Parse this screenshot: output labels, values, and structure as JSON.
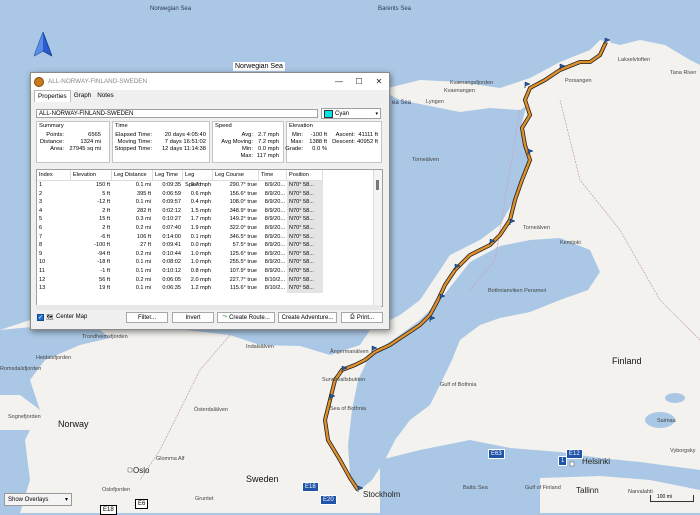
{
  "dialog": {
    "title": "ALL-NORWAY-FINLAND-SWEDEN",
    "tabs": [
      "Properties",
      "Graph",
      "Notes"
    ],
    "track_name": "ALL-NORWAY-FINLAND-SWEDEN",
    "color_label": "Cyan",
    "color_hex": "#00e6e6",
    "summary": {
      "header": "Summary",
      "points_label": "Points:",
      "points": "6565",
      "distance_label": "Distance:",
      "distance": "1324 mi",
      "area_label": "Area:",
      "area": "27945 sq mi"
    },
    "time": {
      "header": "Time",
      "elapsed_label": "Elapsed Time:",
      "elapsed": "20 days 4:05:40",
      "moving_label": "Moving Time:",
      "moving": "7 days 16:51:02",
      "stopped_label": "Stopped Time:",
      "stopped": "12 days 11:14:38"
    },
    "speed": {
      "header": "Speed",
      "avg_label": "Avg:",
      "avg": "2.7 mph",
      "avg_moving_label": "Avg Moving:",
      "avg_moving": "7.2 mph",
      "min_label": "Min:",
      "min": "0.0 mph",
      "max_label": "Max:",
      "max": "117 mph"
    },
    "elevation": {
      "header": "Elevation",
      "min_label": "Min:",
      "min": "-100 ft",
      "max_label": "Max:",
      "max": "1388 ft",
      "grade_label": "Grade:",
      "grade": "0.0 %",
      "ascent_label": "Ascent:",
      "ascent": "41111 ft",
      "descent_label": "Descent:",
      "descent": "40952 ft"
    },
    "table": {
      "columns": [
        "Index",
        "Elevation",
        "Leg Distance",
        "Leg Time",
        "Leg Speed",
        "Leg Course",
        "Time",
        "Position"
      ],
      "rows": [
        [
          "1",
          "150 ft",
          "0.1 mi",
          "0:09:35",
          "0.7 mph",
          "290.7° true",
          "8/9/20...",
          "N70° 58..."
        ],
        [
          "2",
          "5 ft",
          "395 ft",
          "0:06:59",
          "0.6 mph",
          "156.6° true",
          "8/9/20...",
          "N70° 58..."
        ],
        [
          "3",
          "-12 ft",
          "0.1 mi",
          "0:09:57",
          "0.4 mph",
          "108.0° true",
          "8/9/20...",
          "N70° 58..."
        ],
        [
          "4",
          "2 ft",
          "282 ft",
          "0:02:12",
          "1.5 mph",
          "348.9° true",
          "8/9/20...",
          "N70° 58..."
        ],
        [
          "5",
          "15 ft",
          "0.3 mi",
          "0:10:27",
          "1.7 mph",
          "149.2° true",
          "8/9/20...",
          "N70° 58..."
        ],
        [
          "6",
          "2 ft",
          "0.2 mi",
          "0:07:40",
          "1.9 mph",
          "322.0° true",
          "8/9/20...",
          "N70° 58..."
        ],
        [
          "7",
          "-6 ft",
          "106 ft",
          "0:14:00",
          "0.1 mph",
          "346.5° true",
          "8/9/20...",
          "N70° 58..."
        ],
        [
          "8",
          "-100 ft",
          "27 ft",
          "0:09:41",
          "0.0 mph",
          "57.5° true",
          "8/9/20...",
          "N70° 58..."
        ],
        [
          "9",
          "-94 ft",
          "0.2 mi",
          "0:10:44",
          "1.0 mph",
          "125.6° true",
          "8/9/20...",
          "N70° 58..."
        ],
        [
          "10",
          "-18 ft",
          "0.1 mi",
          "0:08:02",
          "1.0 mph",
          "255.5° true",
          "8/9/20...",
          "N70° 58..."
        ],
        [
          "11",
          "-1 ft",
          "0.1 mi",
          "0:10:12",
          "0.8 mph",
          "107.9° true",
          "8/9/20...",
          "N70° 58..."
        ],
        [
          "12",
          "56 ft",
          "0.2 mi",
          "0:06:05",
          "2.0 mph",
          "227.7° true",
          "8/10/2...",
          "N70° 58..."
        ],
        [
          "13",
          "19 ft",
          "0.1 mi",
          "0:06:35",
          "1.2 mph",
          "115.6° true",
          "8/10/2...",
          "N70° 58..."
        ]
      ]
    },
    "buttons": {
      "center_map": "Center Map",
      "filter": "Filter...",
      "invert": "Invert",
      "create_route": "Create Route...",
      "create_adventure": "Create Adventure...",
      "print": "Print..."
    },
    "window_buttons": {
      "minimize": "—",
      "maximize": "☐",
      "close": "✕"
    }
  },
  "map": {
    "labels": {
      "norwegian_sea_top": "Norwegian Sea",
      "barents_sea": "Barents Sea",
      "norwegian_sea_box": "Norwegian Sea",
      "lakselv": "Lakselvloften",
      "tana_river": "Tana River",
      "porsangen": "Porsangen",
      "kvaenangen": "Kvænangsfjorden",
      "kvaenangen2": "Kvaenangen",
      "lyngen": "Lyngen",
      "sea_frag": "ea Sea",
      "torneaelven": "Torneälven",
      "torneelven": "Torneälven",
      "kemijoki": "Kemijoki",
      "bothnian_bay": "Bothnianviken Perameri",
      "indalsalven": "Indalsälven",
      "trondheimsfjorden": "Trondheimsfjorden",
      "heidalsfjorden": "Heidalsfjorden",
      "romsdalsfjorden": "Romsdalsfjorden",
      "angermanalven": "Ångermanälven",
      "sundsvall": "Sundsvallsbukten",
      "gulf_of_bothnia": "Gulf of Bothnia",
      "sea_of_bothnia": "Sea of Bothnia",
      "finland": "Finland",
      "saimaa": "Saimaa",
      "vyborgsky": "Vyborgsky",
      "norway": "Norway",
      "sognefjorden": "Sognefjorden",
      "oslo": "Oslo",
      "oslofjorden": "Oslofjorden",
      "glomma": "Glomma Alf",
      "osterdalalven": "Österdalälven",
      "sweden": "Sweden",
      "gruntet": "Gruntet",
      "stockholm": "Stockholm",
      "baltic_sea": "Baltic Sea",
      "gulf_of_finland": "Gulf of Finland",
      "helsinki": "Helsinki",
      "tallinn": "Tallinn",
      "narva": "Narvalahti"
    },
    "roads": {
      "e6": "E6",
      "e18": "E18",
      "e18b": "E18",
      "e20": "E20",
      "e63": "E63",
      "r1": "1",
      "e12": "E12"
    },
    "overlays_dropdown": "Show Overlays",
    "scale_label": "100 mi"
  }
}
